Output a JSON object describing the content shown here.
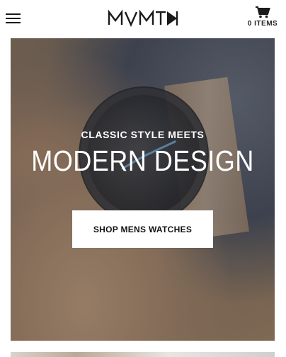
{
  "header": {
    "menu_icon": "hamburger-menu-icon",
    "logo_text": "MVMT",
    "cart": {
      "icon": "shopping-cart-icon",
      "count_label": "0 ITEMS"
    }
  },
  "hero": {
    "eyebrow": "CLASSIC STYLE MEETS",
    "headline": "MODERN DESIGN",
    "cta_label": "SHOP MENS WATCHES"
  },
  "colors": {
    "header_bg": "#ffffff",
    "text_dark": "#111111",
    "hero_text": "#ffffff",
    "cta_bg": "#ffffff",
    "watch_accent": "#6fa9d8"
  }
}
